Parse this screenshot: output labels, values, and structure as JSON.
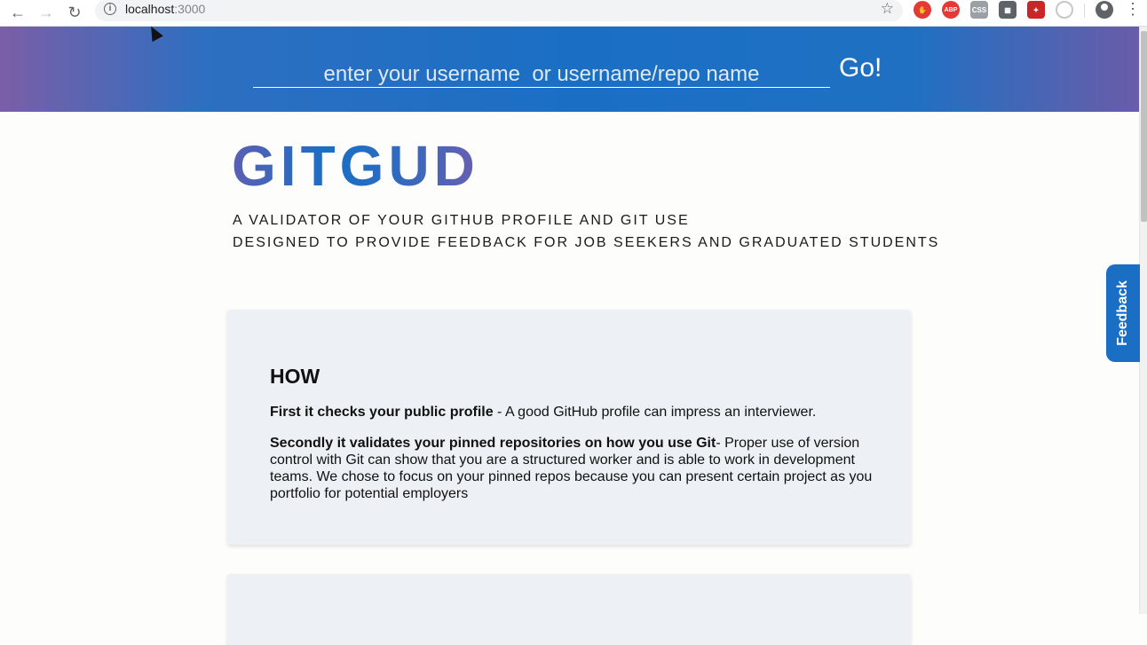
{
  "browser": {
    "url_host": "localhost",
    "url_port": ":3000",
    "back_icon": "arrow-left-icon",
    "forward_icon": "arrow-right-icon",
    "reload_icon": "reload-icon"
  },
  "header": {
    "search_placeholder": "enter your username  or username/repo name",
    "go_label": "Go!"
  },
  "hero": {
    "brand": "GITGUD",
    "tagline_line1": "A VALIDATOR OF YOUR GITHUB PROFILE AND GIT USE",
    "tagline_line2": "DESIGNED TO PROVIDE FEEDBACK FOR JOB SEEKERS AND GRADUATED STUDENTS"
  },
  "how_card": {
    "title": "HOW",
    "p1_bold": "First it checks your public profile",
    "p1_text": " - A good GitHub profile can impress an interviewer.",
    "p2_bold": "Secondly it validates your pinned repositories on how you use Git",
    "p2_text": "- Proper use of version control with Git can show that you are a structured worker and is able to work in development teams. We chose to focus on your pinned repos because you can present certain project as you portfolio for potential employers"
  },
  "feedback_tab": {
    "label": "Feedback"
  },
  "colors": {
    "accent": "#1a6fc4",
    "card_bg": "#edf0f4",
    "page_bg": "#fdfdfb"
  }
}
